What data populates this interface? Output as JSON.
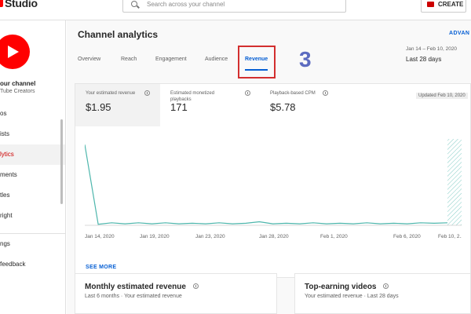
{
  "header": {
    "brand": "Studio",
    "search_placeholder": "Search across your channel",
    "create_label": "CREATE"
  },
  "sidebar": {
    "channel_name": "our channel",
    "channel_sub": "Tube Creators",
    "items": [
      {
        "label": "os"
      },
      {
        "label": "ists"
      },
      {
        "label": "lytics"
      },
      {
        "label": "ments"
      },
      {
        "label": "tles"
      },
      {
        "label": "right"
      },
      {
        "label": "ngs"
      },
      {
        "label": "feedback"
      }
    ]
  },
  "page": {
    "title": "Channel analytics",
    "advanced": "ADVAN",
    "tabs": [
      "Overview",
      "Reach",
      "Engagement",
      "Audience",
      "Revenue"
    ],
    "annotation": "3",
    "date_range": "Jan 14 – Feb 10, 2020",
    "date_label": "Last 28 days"
  },
  "metrics": [
    {
      "label": "Your estimated revenue",
      "value": "$1.95"
    },
    {
      "label": "Estimated monetized playbacks",
      "value": "171"
    },
    {
      "label": "Playback-based CPM",
      "value": "$5.78"
    }
  ],
  "updated": "Updated Feb 10, 2020",
  "chart_data": {
    "type": "line",
    "x_ticks": [
      "Jan 14, 2020",
      "Jan 19, 2020",
      "Jan 23, 2020",
      "Jan 28, 2020",
      "Feb 1, 2020",
      "Feb 6, 2020",
      "Feb 10, 2..."
    ],
    "series": [
      {
        "values": [
          1.6,
          0.02,
          0.05,
          0.03,
          0.05,
          0.03,
          0.05,
          0.03,
          0.04,
          0.03,
          0.05,
          0.03,
          0.04,
          0.07,
          0.03,
          0.04,
          0.03,
          0.05,
          0.03,
          0.04,
          0.03,
          0.05,
          0.03,
          0.04,
          0.03,
          0.05,
          0.04,
          0.05
        ]
      }
    ],
    "ylim": [
      0,
      1.65
    ],
    "grid": false,
    "color": "#4db6ac"
  },
  "see_more": "SEE MORE",
  "cards": {
    "monthly_title": "Monthly estimated revenue",
    "monthly_sub": "Last 6 months · Your estimated revenue",
    "top_title": "Top-earning videos",
    "top_sub": "Your estimated revenue · Last 28 days"
  }
}
